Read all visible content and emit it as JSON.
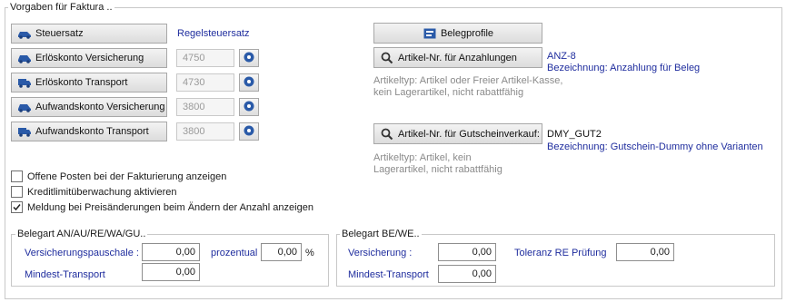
{
  "main_group": {
    "title": "Vorgaben für Faktura .."
  },
  "tax": {
    "button_label": "Steuersatz",
    "value": "Regelsteuersatz"
  },
  "accounts": [
    {
      "label": "Erlöskonto Versicherung",
      "value": "4750"
    },
    {
      "label": "Erlöskonto Transport",
      "value": "4730"
    },
    {
      "label": "Aufwandskonto Versicherung",
      "value": "3800"
    },
    {
      "label": "Aufwandskonto Transport",
      "value": "3800"
    }
  ],
  "belegprofile": {
    "label": "Belegprofile"
  },
  "anzahlung": {
    "button_label": "Artikel-Nr. für Anzahlungen",
    "code": "ANZ-8",
    "description": "Bezeichnung: Anzahlung für Beleg",
    "hint_line1": "Artikeltyp: Artikel oder Freier Artikel-Kasse,",
    "hint_line2": "kein Lagerartikel, nicht rabattfähig"
  },
  "gutschein": {
    "button_label": "Artikel-Nr. für Gutscheinverkauf:",
    "code": "DMY_GUT2",
    "description": "Bezeichnung: Gutschein-Dummy ohne Varianten",
    "hint_line1": "Artikeltyp: Artikel, kein",
    "hint_line2": "Lagerartikel, nicht rabattfähig"
  },
  "checkboxes": [
    {
      "label": "Offene Posten bei der Fakturierung anzeigen",
      "checked": false
    },
    {
      "label": "Kreditlimitüberwachung aktivieren",
      "checked": false
    },
    {
      "label": "Meldung bei Preisänderungen beim Ändern der Anzahl anzeigen",
      "checked": true
    }
  ],
  "group_an": {
    "title": "Belegart AN/AU/RE/WA/GU..",
    "versicherung_label": "Versicherungspauschale :",
    "versicherung_value": "0,00",
    "prozentual_label": "prozentual",
    "prozentual_value": "0,00",
    "percent_sign": "%",
    "mindest_label": "Mindest-Transport",
    "mindest_value": "0,00"
  },
  "group_be": {
    "title": "Belegart BE/WE..",
    "versicherung_label": "Versicherung :",
    "versicherung_value": "0,00",
    "toleranz_label": "Toleranz RE Prüfung",
    "toleranz_value": "0,00",
    "mindest_label": "Mindest-Transport",
    "mindest_value": "0,00"
  },
  "colors": {
    "link_blue": "#1f2d9e",
    "hint_grey": "#8a8a8a",
    "icon_blue": "#2a5aa8"
  }
}
